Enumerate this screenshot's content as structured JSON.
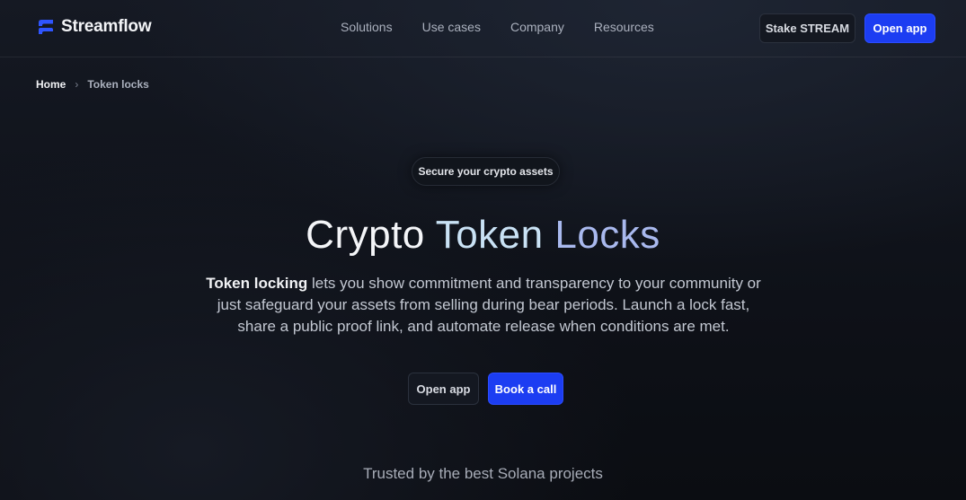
{
  "brand": {
    "name": "Streamflow",
    "color": "#2f55ff"
  },
  "nav": {
    "items": [
      "Solutions",
      "Use cases",
      "Company",
      "Resources"
    ],
    "stake_label": "Stake STREAM",
    "open_app_label": "Open app"
  },
  "breadcrumb": {
    "home": "Home",
    "separator": "›",
    "current": "Token locks"
  },
  "hero": {
    "badge": "Secure your crypto assets",
    "title": {
      "part1": "Crypto",
      "part2": "Token",
      "part3": "Locks"
    },
    "desc_strong": "Token locking",
    "desc_rest": " lets you show commitment and transparency to your community or just safeguard your assets from selling during bear periods. Launch a lock fast, share a public proof link, and automate release when conditions are met.",
    "open_app_label": "Open app",
    "book_call_label": "Book a call"
  },
  "trusted": {
    "text": "Trusted by the best Solana projects"
  },
  "colors": {
    "accent_blue": "#1c3df2",
    "title_blue_light": "#c9e2f5",
    "title_blue": "#a9b9ee"
  }
}
